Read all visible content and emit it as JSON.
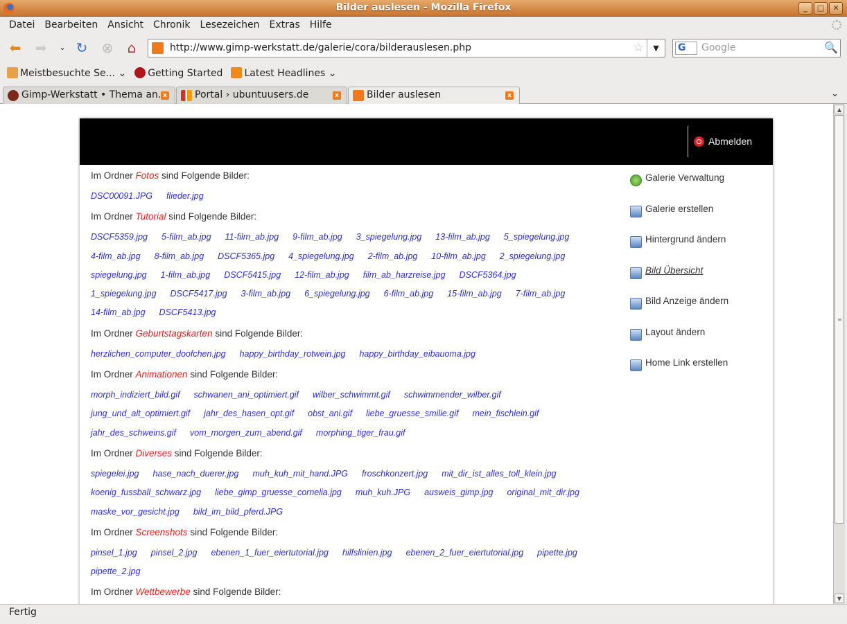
{
  "window": {
    "title": "Bilder auslesen - Mozilla Firefox",
    "controls": [
      "_",
      "□",
      "✕"
    ]
  },
  "menu": [
    "Datei",
    "Bearbeiten",
    "Ansicht",
    "Chronik",
    "Lesezeichen",
    "Extras",
    "Hilfe"
  ],
  "nav": {
    "url": "http://www.gimp-werkstatt.de/galerie/cora/bilderauslesen.php",
    "search_placeholder": "Google",
    "search_engine": "G"
  },
  "bookmarks": [
    "Meistbesuchte Se...",
    "Getting Started",
    "Latest Headlines"
  ],
  "tabs": [
    {
      "label": "Gimp-Werkstatt • Thema an..."
    },
    {
      "label": "Portal › ubuntuusers.de"
    },
    {
      "label": "Bilder auslesen"
    }
  ],
  "header": {
    "logout": "Abmelden"
  },
  "labels": {
    "prefix": "Im Ordner ",
    "suffix": " sind Folgende Bilder:"
  },
  "folders": [
    {
      "name": "Fotos",
      "rows": [
        [
          "DSC00091.JPG",
          "flieder.jpg"
        ]
      ]
    },
    {
      "name": "Tutorial",
      "rows": [
        [
          "DSCF5359.jpg",
          "5-film_ab.jpg",
          "11-film_ab.jpg",
          "9-film_ab.jpg",
          "3_spiegelung.jpg",
          "13-film_ab.jpg",
          "5_spiegelung.jpg"
        ],
        [
          "4-film_ab.jpg",
          "8-film_ab.jpg",
          "DSCF5365.jpg",
          "4_spiegelung.jpg",
          "2-film_ab.jpg",
          "10-film_ab.jpg",
          "2_spiegelung.jpg"
        ],
        [
          "spiegelung.jpg",
          "1-film_ab.jpg",
          "DSCF5415.jpg",
          "12-film_ab.jpg",
          "film_ab_harzreise.jpg",
          "DSCF5364.jpg"
        ],
        [
          "1_spiegelung.jpg",
          "DSCF5417.jpg",
          "3-film_ab.jpg",
          "6_spiegelung.jpg",
          "6-film_ab.jpg",
          "15-film_ab.jpg",
          "7-film_ab.jpg"
        ],
        [
          "14-film_ab.jpg",
          "DSCF5413.jpg"
        ]
      ]
    },
    {
      "name": "Geburtstagskarten",
      "rows": [
        [
          "herzlichen_computer_doofchen.jpg",
          "happy_birthday_rotwein.jpg",
          "happy_birthday_eibauoma.jpg"
        ]
      ]
    },
    {
      "name": "Animationen",
      "rows": [
        [
          "morph_indiziert_bild.gif",
          "schwanen_ani_optimiert.gif",
          "wilber_schwimmt.gif",
          "schwimmender_wilber.gif"
        ],
        [
          "jung_und_alt_optimiert.gif",
          "jahr_des_hasen_opt.gif",
          "obst_ani.gif",
          "liebe_gruesse_smilie.gif",
          "mein_fischlein.gif"
        ],
        [
          "jahr_des_schweins.gif",
          "vom_morgen_zum_abend.gif",
          "morphing_tiger_frau.gif"
        ]
      ]
    },
    {
      "name": "Diverses",
      "rows": [
        [
          "spiegelei.jpg",
          "hase_nach_duerer.jpg",
          "muh_kuh_mit_hand.JPG",
          "froschkonzert.jpg",
          "mit_dir_ist_alles_toll_klein.jpg"
        ],
        [
          "koenig_fussball_schwarz.jpg",
          "liebe_gimp_gruesse_cornelia.jpg",
          "muh_kuh.JPG",
          "ausweis_gimp.jpg",
          "original_mit_dir.jpg"
        ],
        [
          "maske_vor_gesicht.jpg",
          "bild_im_bild_pferd.JPG"
        ]
      ]
    },
    {
      "name": "Screenshots",
      "rows": [
        [
          "pinsel_1.jpg",
          "pinsel_2.jpg",
          "ebenen_1_fuer_eiertutorial.jpg",
          "hilfslinien.jpg",
          "ebenen_2_fuer_eiertutorial.jpg",
          "pipette.jpg"
        ],
        [
          "pipette_2.jpg"
        ]
      ]
    },
    {
      "name": "Wettbewerbe",
      "rows": []
    }
  ],
  "sidebar": [
    {
      "label": "Galerie Verwaltung",
      "icon": "refresh-icon"
    },
    {
      "label": "Galerie erstellen",
      "icon": "gallery-add-icon"
    },
    {
      "label": "Hintergrund ändern",
      "icon": "background-icon"
    },
    {
      "label": "Bild Übersicht",
      "icon": "images-icon",
      "active": true
    },
    {
      "label": "Bild Anzeige ändern",
      "icon": "image-edit-icon"
    },
    {
      "label": "Layout ändern",
      "icon": "layout-icon"
    },
    {
      "label": "Home Link erstellen",
      "icon": "home-link-icon"
    }
  ],
  "status": "Fertig"
}
